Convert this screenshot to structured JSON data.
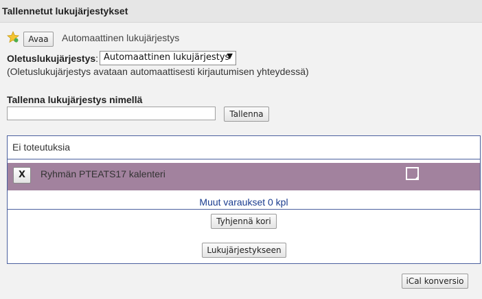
{
  "header": {
    "title": "Tallennetut lukujärjestykset"
  },
  "saved": {
    "star_icon": "star-icon",
    "open_button": "Avaa",
    "current_name": "Automaattinen lukujärjestys"
  },
  "default_schedule": {
    "label": "Oletuslukujärjestys",
    "colon": ":",
    "selected": "Automaattinen lukujärjestys",
    "note": "(Oletuslukujärjestys avataan automaattisesti kirjautumisen yhteydessä)"
  },
  "save_as": {
    "label": "Tallenna lukujärjestys nimellä",
    "input_value": "",
    "button": "Tallenna"
  },
  "cart": {
    "empty_text": "Ei toteutuksia",
    "remove_button": "X",
    "item_label": "Ryhmän PTEATS17 kalenteri",
    "item_color": "#a2829e",
    "other_reservations": "Muut varaukset 0 kpl",
    "clear_button": "Tyhjennä kori",
    "to_schedule_button": "Lukujärjestykseen"
  },
  "footer": {
    "ical_button": "iCal konversio"
  }
}
